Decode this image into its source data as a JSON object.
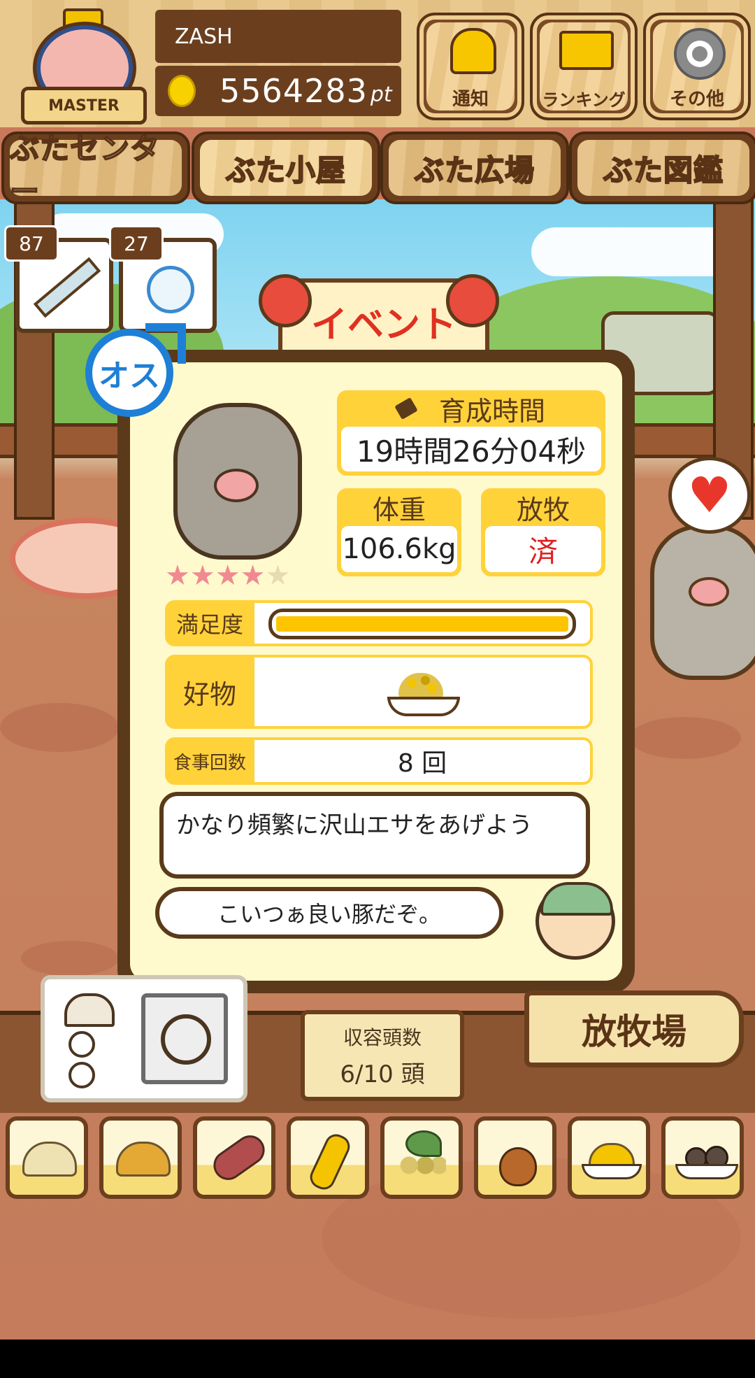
{
  "header": {
    "username": "ZASH",
    "points_value": "5564283",
    "points_unit": "pt",
    "rank_badge": "MASTER",
    "buttons": [
      {
        "label": "通知",
        "icon": "bell-icon"
      },
      {
        "label": "ランキング",
        "icon": "crown-icon"
      },
      {
        "label": "その他",
        "icon": "gear-icon"
      }
    ]
  },
  "nav": {
    "tabs": [
      {
        "label": "ぶたセンター",
        "active": false
      },
      {
        "label": "ぶた小屋",
        "active": true
      },
      {
        "label": "ぶた広場",
        "active": false
      },
      {
        "label": "ぶた図鑑",
        "active": false
      }
    ]
  },
  "items": {
    "syringe_count": "87",
    "stopwatch_count": "27"
  },
  "event_sign": "イベント",
  "gender": {
    "label": "オス"
  },
  "pig": {
    "rating": 4,
    "rating_max": 5,
    "growth_time_label": "育成時間",
    "growth_time_value": "19時間26分04秒",
    "weight_label": "体重",
    "weight_value": "106.6kg",
    "grazing_label": "放牧",
    "grazing_value": "済",
    "satisfaction_label": "満足度",
    "satisfaction_level": 1.0,
    "favorite_label": "好物",
    "favorite_food_icon": "grain-bowl-icon",
    "meals_label": "食事回数",
    "meals_value": "8 回",
    "advice": "かなり頻繁に沢山エサをあげよう",
    "farmer_comment": "こいつぁ良い豚だぞ。"
  },
  "capacity": {
    "label": "収容頭数",
    "value": "6/10 頭"
  },
  "pasture_sign": "放牧場",
  "food_bar": [
    {
      "icon": "beige-grain-icon"
    },
    {
      "icon": "mixed-grain-icon"
    },
    {
      "icon": "sweet-potato-icon"
    },
    {
      "icon": "corn-icon"
    },
    {
      "icon": "beans-icon"
    },
    {
      "icon": "acorn-icon"
    },
    {
      "icon": "grain-plate-icon"
    },
    {
      "icon": "meatball-plate-icon"
    }
  ],
  "colors": {
    "accent_yellow": "#ffd23a",
    "wood_dark": "#5a3a1a",
    "panel_bg": "#fffacd",
    "done_red": "#e02020",
    "gender_blue": "#1e7fd6"
  }
}
